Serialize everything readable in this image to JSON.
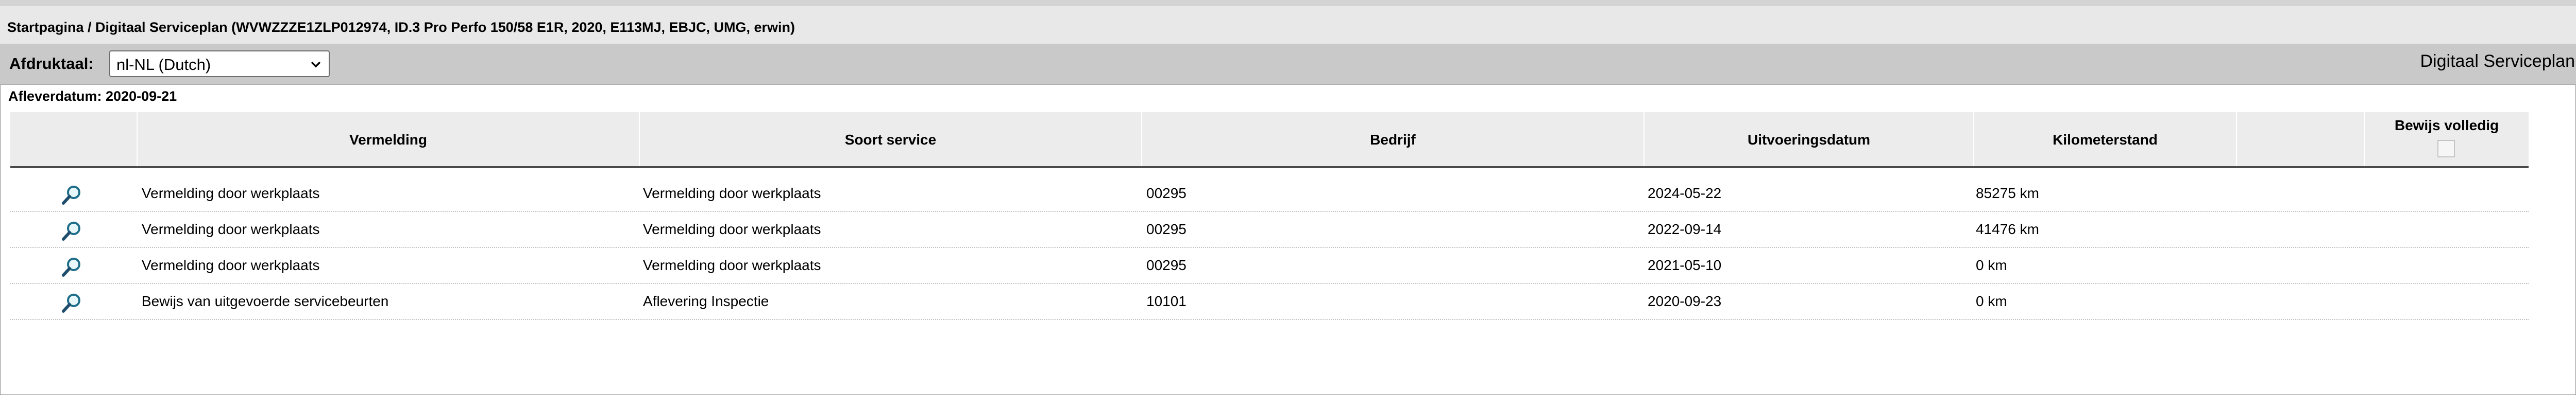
{
  "breadcrumb": "Startpagina / Digitaal Serviceplan (WVWZZZE1ZLP012974, ID.3 Pro Perfo 150/58 E1R, 2020, E113MJ, EBJC, UMG, erwin)",
  "toolbar": {
    "print_language_label": "Afdruktaal:",
    "print_language_value": "nl-NL (Dutch)",
    "page_heading": "Digitaal Serviceplan"
  },
  "delivery_date": "Afleverdatum: 2020-09-21",
  "table": {
    "headers": {
      "entry": "Vermelding",
      "service_type": "Soort service",
      "company": "Bedrijf",
      "execution_date": "Uitvoeringsdatum",
      "mileage": "Kilometerstand",
      "proof_complete": "Bewijs volledig"
    },
    "rows": [
      {
        "icon": "magnifier-view-icon",
        "entry": "Vermelding door werkplaats",
        "service_type": "Vermelding door werkplaats",
        "company": "00295",
        "execution_date": "2024-05-22",
        "mileage": "85275 km"
      },
      {
        "icon": "magnifier-view-icon",
        "entry": "Vermelding door werkplaats",
        "service_type": "Vermelding door werkplaats",
        "company": "00295",
        "execution_date": "2022-09-14",
        "mileage": "41476 km"
      },
      {
        "icon": "magnifier-view-icon",
        "entry": "Vermelding door werkplaats",
        "service_type": "Vermelding door werkplaats",
        "company": "00295",
        "execution_date": "2021-05-10",
        "mileage": "0 km"
      },
      {
        "icon": "magnifier-view-icon",
        "entry": "Bewijs van uitgevoerde servicebeurten",
        "service_type": "Aflevering Inspectie",
        "company": "10101",
        "execution_date": "2020-09-23",
        "mileage": "0 km"
      }
    ]
  }
}
